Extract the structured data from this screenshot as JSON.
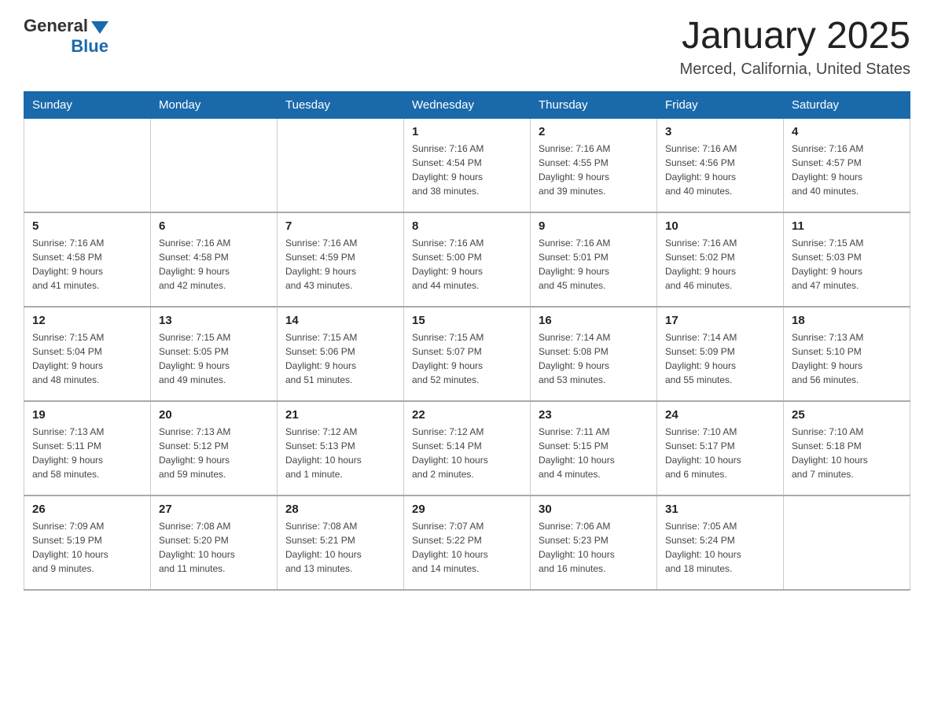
{
  "header": {
    "logo": {
      "general": "General",
      "blue": "Blue"
    },
    "title": "January 2025",
    "location": "Merced, California, United States"
  },
  "calendar": {
    "days_of_week": [
      "Sunday",
      "Monday",
      "Tuesday",
      "Wednesday",
      "Thursday",
      "Friday",
      "Saturday"
    ],
    "weeks": [
      [
        {
          "day": "",
          "info": ""
        },
        {
          "day": "",
          "info": ""
        },
        {
          "day": "",
          "info": ""
        },
        {
          "day": "1",
          "info": "Sunrise: 7:16 AM\nSunset: 4:54 PM\nDaylight: 9 hours\nand 38 minutes."
        },
        {
          "day": "2",
          "info": "Sunrise: 7:16 AM\nSunset: 4:55 PM\nDaylight: 9 hours\nand 39 minutes."
        },
        {
          "day": "3",
          "info": "Sunrise: 7:16 AM\nSunset: 4:56 PM\nDaylight: 9 hours\nand 40 minutes."
        },
        {
          "day": "4",
          "info": "Sunrise: 7:16 AM\nSunset: 4:57 PM\nDaylight: 9 hours\nand 40 minutes."
        }
      ],
      [
        {
          "day": "5",
          "info": "Sunrise: 7:16 AM\nSunset: 4:58 PM\nDaylight: 9 hours\nand 41 minutes."
        },
        {
          "day": "6",
          "info": "Sunrise: 7:16 AM\nSunset: 4:58 PM\nDaylight: 9 hours\nand 42 minutes."
        },
        {
          "day": "7",
          "info": "Sunrise: 7:16 AM\nSunset: 4:59 PM\nDaylight: 9 hours\nand 43 minutes."
        },
        {
          "day": "8",
          "info": "Sunrise: 7:16 AM\nSunset: 5:00 PM\nDaylight: 9 hours\nand 44 minutes."
        },
        {
          "day": "9",
          "info": "Sunrise: 7:16 AM\nSunset: 5:01 PM\nDaylight: 9 hours\nand 45 minutes."
        },
        {
          "day": "10",
          "info": "Sunrise: 7:16 AM\nSunset: 5:02 PM\nDaylight: 9 hours\nand 46 minutes."
        },
        {
          "day": "11",
          "info": "Sunrise: 7:15 AM\nSunset: 5:03 PM\nDaylight: 9 hours\nand 47 minutes."
        }
      ],
      [
        {
          "day": "12",
          "info": "Sunrise: 7:15 AM\nSunset: 5:04 PM\nDaylight: 9 hours\nand 48 minutes."
        },
        {
          "day": "13",
          "info": "Sunrise: 7:15 AM\nSunset: 5:05 PM\nDaylight: 9 hours\nand 49 minutes."
        },
        {
          "day": "14",
          "info": "Sunrise: 7:15 AM\nSunset: 5:06 PM\nDaylight: 9 hours\nand 51 minutes."
        },
        {
          "day": "15",
          "info": "Sunrise: 7:15 AM\nSunset: 5:07 PM\nDaylight: 9 hours\nand 52 minutes."
        },
        {
          "day": "16",
          "info": "Sunrise: 7:14 AM\nSunset: 5:08 PM\nDaylight: 9 hours\nand 53 minutes."
        },
        {
          "day": "17",
          "info": "Sunrise: 7:14 AM\nSunset: 5:09 PM\nDaylight: 9 hours\nand 55 minutes."
        },
        {
          "day": "18",
          "info": "Sunrise: 7:13 AM\nSunset: 5:10 PM\nDaylight: 9 hours\nand 56 minutes."
        }
      ],
      [
        {
          "day": "19",
          "info": "Sunrise: 7:13 AM\nSunset: 5:11 PM\nDaylight: 9 hours\nand 58 minutes."
        },
        {
          "day": "20",
          "info": "Sunrise: 7:13 AM\nSunset: 5:12 PM\nDaylight: 9 hours\nand 59 minutes."
        },
        {
          "day": "21",
          "info": "Sunrise: 7:12 AM\nSunset: 5:13 PM\nDaylight: 10 hours\nand 1 minute."
        },
        {
          "day": "22",
          "info": "Sunrise: 7:12 AM\nSunset: 5:14 PM\nDaylight: 10 hours\nand 2 minutes."
        },
        {
          "day": "23",
          "info": "Sunrise: 7:11 AM\nSunset: 5:15 PM\nDaylight: 10 hours\nand 4 minutes."
        },
        {
          "day": "24",
          "info": "Sunrise: 7:10 AM\nSunset: 5:17 PM\nDaylight: 10 hours\nand 6 minutes."
        },
        {
          "day": "25",
          "info": "Sunrise: 7:10 AM\nSunset: 5:18 PM\nDaylight: 10 hours\nand 7 minutes."
        }
      ],
      [
        {
          "day": "26",
          "info": "Sunrise: 7:09 AM\nSunset: 5:19 PM\nDaylight: 10 hours\nand 9 minutes."
        },
        {
          "day": "27",
          "info": "Sunrise: 7:08 AM\nSunset: 5:20 PM\nDaylight: 10 hours\nand 11 minutes."
        },
        {
          "day": "28",
          "info": "Sunrise: 7:08 AM\nSunset: 5:21 PM\nDaylight: 10 hours\nand 13 minutes."
        },
        {
          "day": "29",
          "info": "Sunrise: 7:07 AM\nSunset: 5:22 PM\nDaylight: 10 hours\nand 14 minutes."
        },
        {
          "day": "30",
          "info": "Sunrise: 7:06 AM\nSunset: 5:23 PM\nDaylight: 10 hours\nand 16 minutes."
        },
        {
          "day": "31",
          "info": "Sunrise: 7:05 AM\nSunset: 5:24 PM\nDaylight: 10 hours\nand 18 minutes."
        },
        {
          "day": "",
          "info": ""
        }
      ]
    ]
  }
}
